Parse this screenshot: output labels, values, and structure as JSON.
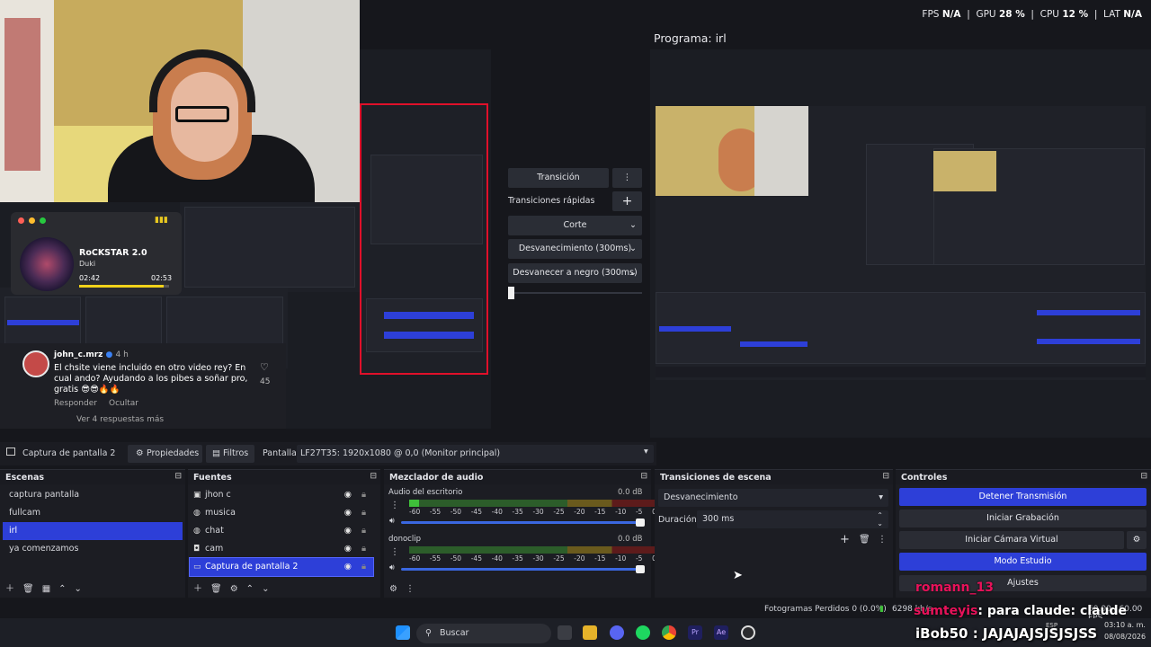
{
  "stats": {
    "fps_label": "FPS",
    "fps": "N/A",
    "gpu_label": "GPU",
    "gpu": "28 %",
    "cpu_label": "CPU",
    "cpu": "12 %",
    "lat_label": "LAT",
    "lat": "N/A"
  },
  "program_title": "Programa: irl",
  "overlay": {
    "track": "RoCKSTAR 2.0",
    "artist": "Duki",
    "time_elapsed": "02:42",
    "time_total": "02:53",
    "progress_fraction": 0.94,
    "comment_user": "john_c.mrz",
    "comment_time": "4 h",
    "comment_text": "El chsite viene incluido en otro video rey? En cual ando? Ayudando a los pibes a soñar pro, gratis 😎😎🔥🔥",
    "comment_likes": "45",
    "reply": "Responder",
    "hide": "Ocultar",
    "see_replies": "Ver 4 respuestas más"
  },
  "transitions_panel": {
    "transition": "Transición",
    "quick": "Transiciones rápidas",
    "cut": "Corte",
    "fade": "Desvanecimiento (300ms)",
    "fade_black": "Desvanecer a negro (300ms)"
  },
  "source_bar": {
    "source": "Captura de pantalla 2",
    "properties": "Propiedades",
    "filters": "Filtros",
    "screen_label": "Pantalla",
    "screen_value": "LF27T35: 1920x1080 @ 0,0 (Monitor principal)"
  },
  "scenes": {
    "title": "Escenas",
    "items": [
      "captura pantalla",
      "fullcam",
      "irl",
      "ya comenzamos"
    ],
    "selected": 2
  },
  "sources": {
    "title": "Fuentes",
    "items": [
      {
        "name": "jhon c",
        "icon": "image-icon"
      },
      {
        "name": "musica",
        "icon": "globe-icon"
      },
      {
        "name": "chat",
        "icon": "globe-icon"
      },
      {
        "name": "cam",
        "icon": "camera-icon"
      },
      {
        "name": "Captura de pantalla 2",
        "icon": "monitor-icon"
      }
    ],
    "selected": 4
  },
  "mixer": {
    "title": "Mezclador de audio",
    "channels": [
      {
        "name": "Audio del escritorio",
        "db": "0.0 dB",
        "level": 0.04
      },
      {
        "name": "donoclip",
        "db": "0.0 dB",
        "level": 0
      }
    ],
    "ticks": [
      "-60",
      "-55",
      "-50",
      "-45",
      "-40",
      "-35",
      "-30",
      "-25",
      "-20",
      "-15",
      "-10",
      "-5",
      "0"
    ]
  },
  "scene_transitions": {
    "title": "Transiciones de escena",
    "selected": "Desvanecimiento",
    "duration_label": "Duración",
    "duration": "300 ms"
  },
  "controls": {
    "title": "Controles",
    "stop_stream": "Detener Transmisión",
    "start_rec": "Iniciar Grabación",
    "virtual_cam": "Iniciar Cámara Virtual",
    "studio": "Modo Estudio",
    "settings": "Ajustes"
  },
  "status": {
    "dropped": "Fotogramas Perdidos 0 (0.0%)",
    "kbps": "6298 kb/s",
    "fps": "60.00 / 60.00 FPS"
  },
  "taskbar": {
    "search": "Buscar",
    "time": "03:10 a. m.",
    "date": "08/08/2026",
    "lang": "ESP"
  },
  "chat_overlay": {
    "line1_user": "romann_13",
    "line2_user": "sumteyis",
    "line2_text": ": para claude: claude",
    "line3": "iBob50 : JAJAJAJSJSJSJSS"
  }
}
